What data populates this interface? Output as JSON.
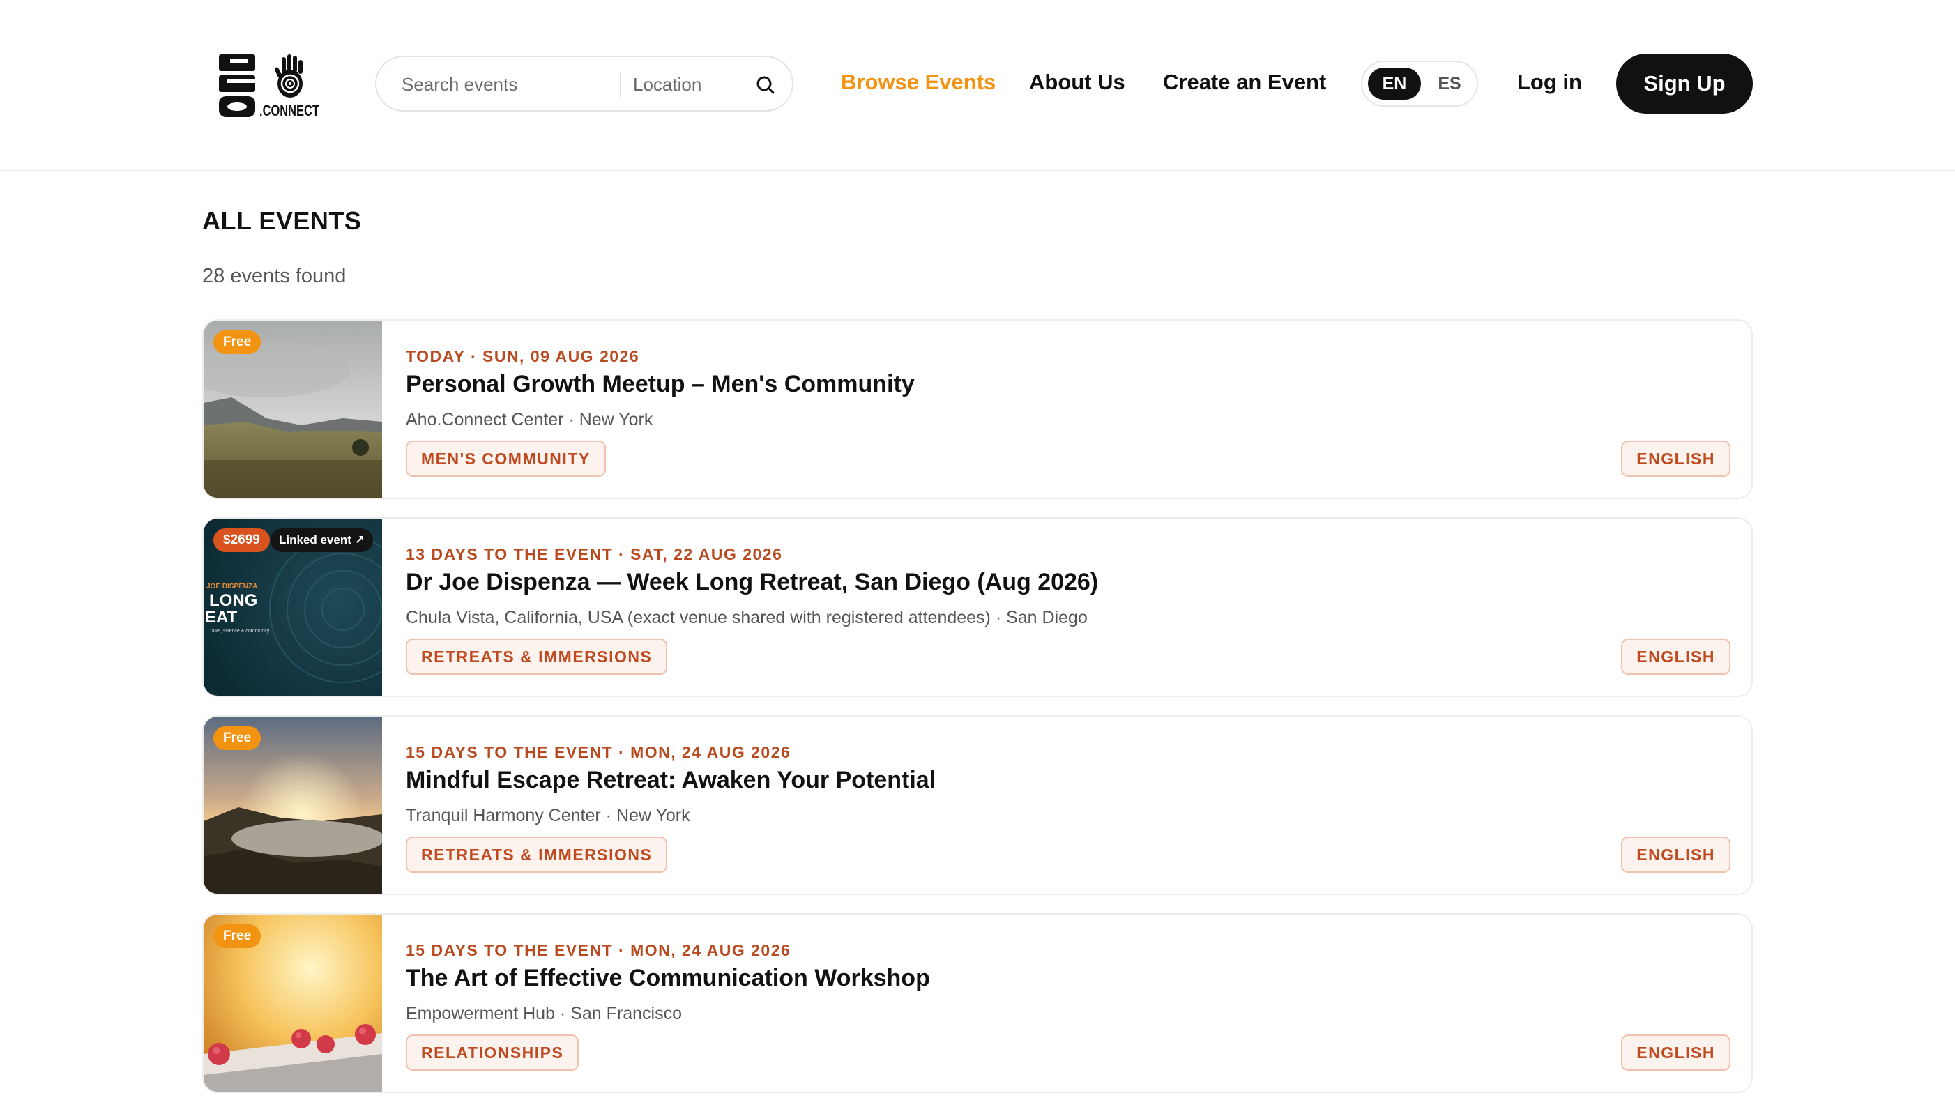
{
  "header": {
    "logo_text": "AHO.CONNECT",
    "search": {
      "placeholder": "Search events",
      "location_placeholder": "Location"
    },
    "nav": {
      "browse": "Browse Events",
      "about": "About Us",
      "create": "Create an Event"
    },
    "languages": [
      "EN",
      "ES"
    ],
    "login": "Log in",
    "signup": "Sign Up"
  },
  "main": {
    "title": "ALL EVENTS",
    "results": "28 events found",
    "events": [
      {
        "badge": "Free",
        "date": "TODAY · SUN, 09 AUG 2026",
        "title": "Personal Growth Meetup – Men's Community",
        "venue": "Aho.Connect Center · New York",
        "category": "MEN'S COMMUNITY",
        "language": "ENGLISH"
      },
      {
        "badge": "$2699",
        "linked": "Linked event ↗",
        "overlay": {
          "small": "JOE DISPENZA",
          "line1": "LONG",
          "line2": "EAT",
          "tiny": "... talks, science & community"
        },
        "date": "13 DAYS TO THE EVENT · SAT, 22 AUG 2026",
        "title": "Dr Joe Dispenza — Week Long Retreat, San Diego (Aug 2026)",
        "venue": "Chula Vista, California, USA (exact venue shared with registered attendees) · San Diego",
        "category": "RETREATS & IMMERSIONS",
        "language": "ENGLISH"
      },
      {
        "badge": "Free",
        "date": "15 DAYS TO THE EVENT · MON, 24 AUG 2026",
        "title": "Mindful Escape Retreat: Awaken Your Potential",
        "venue": "Tranquil Harmony Center · New York",
        "category": "RETREATS & IMMERSIONS",
        "language": "ENGLISH"
      },
      {
        "badge": "Free",
        "date": "15 DAYS TO THE EVENT · MON, 24 AUG 2026",
        "title": "The Art of Effective Communication Workshop",
        "venue": "Empowerment Hub · San Francisco",
        "category": "RELATIONSHIPS",
        "language": "ENGLISH"
      }
    ]
  },
  "colors": {
    "accent": "#f39312",
    "tag_text": "#c04a1f",
    "date_text": "#b94a1f",
    "dark": "#111111"
  }
}
